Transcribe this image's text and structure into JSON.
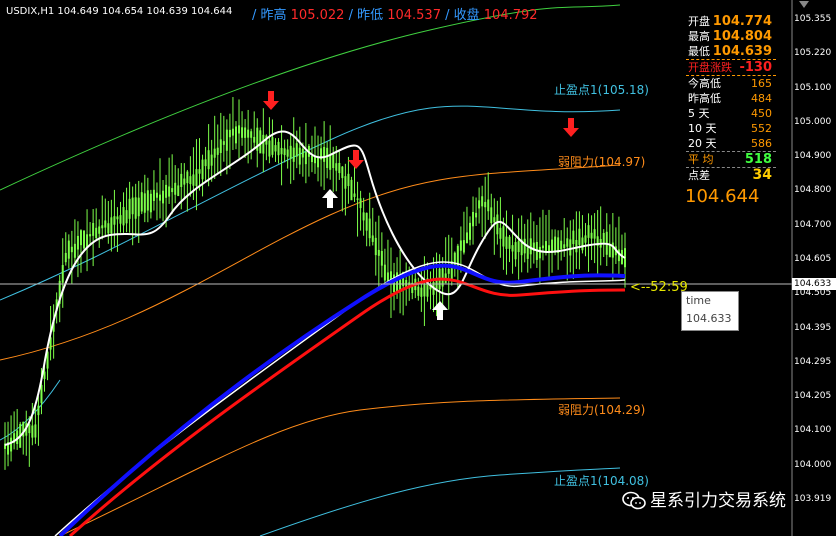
{
  "header": {
    "symbol_line": "USDIX,H1  104.649 104.654 104.639 104.644",
    "yesterday_high_label": "/ 昨高",
    "yesterday_high_value": "105.022",
    "yesterday_low_label": "/ 昨低",
    "yesterday_low_value": "104.537",
    "yesterday_close_label": "/ 收盘",
    "yesterday_close_value": "104.792"
  },
  "panel": {
    "rows": [
      {
        "label": "开盘",
        "value": "104.774"
      },
      {
        "label": "最高",
        "value": "104.804"
      },
      {
        "label": "最低",
        "value": "104.639"
      },
      {
        "label": "开盘涨跌",
        "value": "-130"
      },
      {
        "label": "今高低",
        "value": "165"
      },
      {
        "label": "昨高低",
        "value": "484"
      },
      {
        "label": "5  天",
        "value": "450"
      },
      {
        "label": "10  天",
        "value": "552"
      },
      {
        "label": "20  天",
        "value": "586"
      },
      {
        "label": "平  均",
        "value": "518"
      },
      {
        "label": "点差",
        "value": "34"
      }
    ],
    "current_price": "104.644"
  },
  "levels": {
    "tp_upper": "止盈点1(105.18)",
    "resistance_upper": "弱阻力(104.97)",
    "resistance_lower": "弱阻力(104.29)",
    "tp_lower": "止盈点1(104.08)"
  },
  "tooltip": {
    "title": "time",
    "value": "104.633"
  },
  "cursor_label": "<--52:59",
  "axis": {
    "ticks": [
      "105.355",
      "105.220",
      "105.100",
      "105.000",
      "104.900",
      "104.800",
      "104.700",
      "104.605",
      "104.505",
      "104.395",
      "104.295",
      "104.205",
      "104.100",
      "104.000",
      "103.919"
    ],
    "current": "104.633"
  },
  "watermark": "星系引力交易系统",
  "colors": {
    "background": "#000000",
    "candles": "#7dff4a",
    "blue_ma": "#1010ff",
    "red_ma": "#ff1010",
    "white_ma": "#ffffff",
    "orange_band": "#ff8c1a",
    "cyan_band": "#40c0e0",
    "green_band": "#40d040",
    "arrow_down": "#ff2020",
    "arrow_up": "#ffffff",
    "value_orange": "#ff9900",
    "value_red": "#ff2020",
    "value_green": "#40ff40"
  }
}
